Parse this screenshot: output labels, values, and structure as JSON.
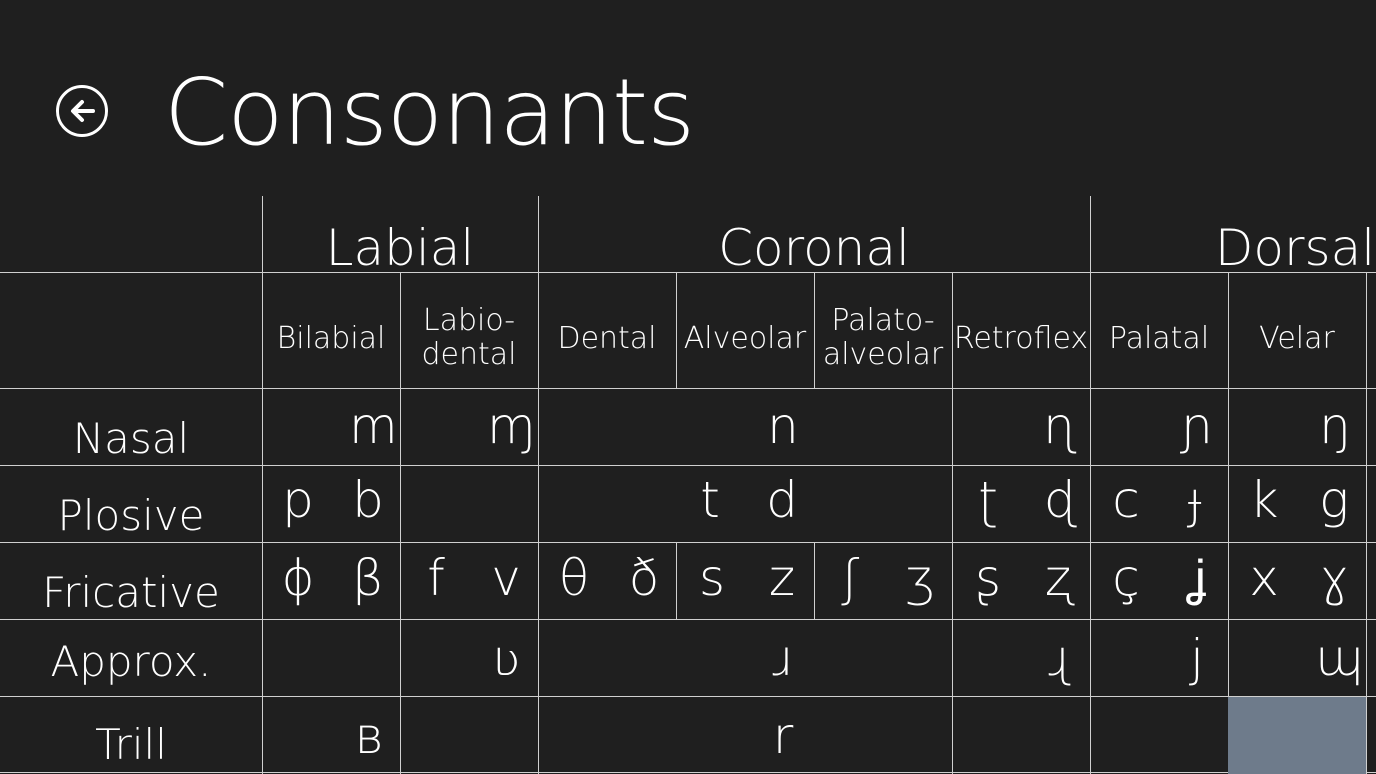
{
  "header": {
    "title": "Consonants",
    "back_icon": "back-arrow-circle-icon"
  },
  "groups": [
    "Labial",
    "Coronal",
    "Dorsal"
  ],
  "places": [
    {
      "line1": "Bilabial",
      "line2": ""
    },
    {
      "line1": "Labio-",
      "line2": "dental"
    },
    {
      "line1": "Dental",
      "line2": ""
    },
    {
      "line1": "Alveolar",
      "line2": ""
    },
    {
      "line1": "Palato-",
      "line2": "alveolar"
    },
    {
      "line1": "Retroflex",
      "line2": ""
    },
    {
      "line1": "Palatal",
      "line2": ""
    },
    {
      "line1": "Velar",
      "line2": ""
    }
  ],
  "manners": [
    "Nasal",
    "Plosive",
    "Fricative",
    "Approx.",
    "Trill"
  ],
  "symbols": {
    "nasal": [
      "m",
      "ɱ",
      "n",
      "ɳ",
      "ɲ",
      "ŋ"
    ],
    "plosive": [
      "p",
      "b",
      "t",
      "d",
      "ʈ",
      "ɖ",
      "c",
      "ɟ",
      "k",
      "g"
    ],
    "fricative": [
      "ɸ",
      "β",
      "f",
      "v",
      "θ",
      "ð",
      "s",
      "z",
      "ʃ",
      "ʒ",
      "ʂ",
      "ʐ",
      "ç",
      "ʝ",
      "x",
      "ɣ"
    ],
    "approx": [
      "ʋ",
      "ɹ",
      "ɻ",
      "j",
      "ɰ"
    ],
    "trill": [
      "ʙ",
      "r"
    ]
  },
  "colors": {
    "background": "#1f1f1f",
    "text": "#ffffff",
    "grid": "#d0d0d0",
    "disabled_cell": "#6e7b8b"
  }
}
